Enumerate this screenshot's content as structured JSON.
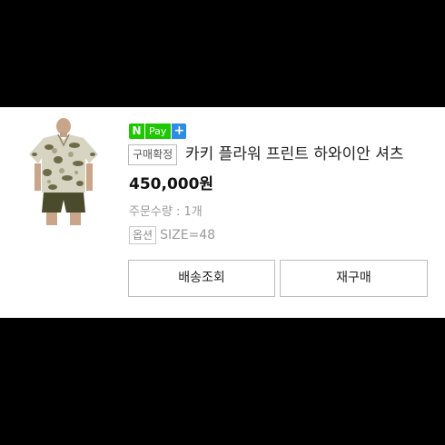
{
  "badge": {
    "n": "N",
    "pay": "Pay",
    "plus": "+",
    "colors": {
      "green": "#1ec800",
      "blue": "#2d8ce6"
    }
  },
  "order": {
    "status": "구매확정",
    "product_name": "카키 플라워 프린트 하와이안 셔츠",
    "price": "450,000원",
    "quantity": "주문수량 : 1개",
    "option_label": "옵션",
    "option_value": "SIZE=48"
  },
  "actions": {
    "track_label": "배송조회",
    "reorder_label": "재구매"
  },
  "thumbnail": {
    "icon": "product-photo"
  }
}
